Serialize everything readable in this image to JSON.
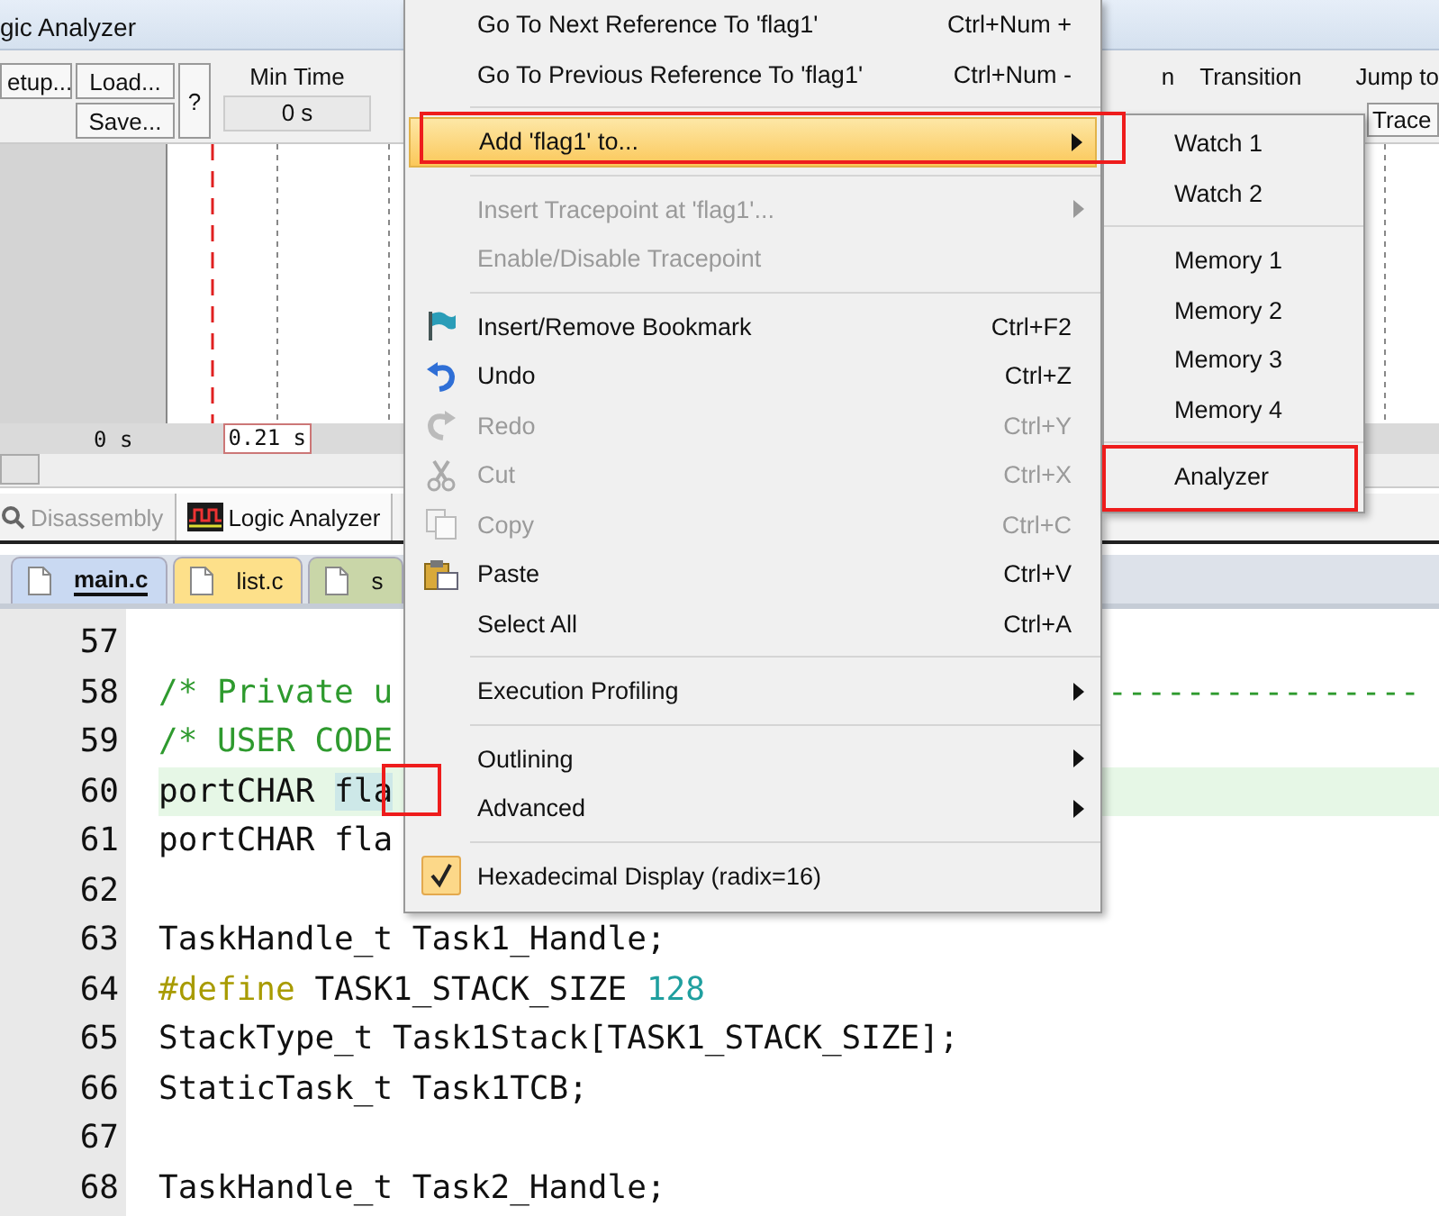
{
  "window": {
    "title": "gic Analyzer"
  },
  "toolbar": {
    "setup": "etup...",
    "load": "Load...",
    "save": "Save...",
    "help": "?",
    "min_time_label": "Min Time",
    "min_time_value": "0 s",
    "cut_label": "n",
    "transition_label": "Transition",
    "jump_label": "Jump to",
    "trace_button": "Trace"
  },
  "plot": {
    "left_time": "0 s",
    "cursor_time": "0.21 s"
  },
  "view_tabs": [
    {
      "label": "Disassembly",
      "selected": false
    },
    {
      "label": "Logic Analyzer",
      "selected": true
    }
  ],
  "file_tabs": [
    {
      "label": "main.c",
      "selected": true,
      "color": "#c9d9f2"
    },
    {
      "label": "list.c",
      "selected": false,
      "color": "#fde08a"
    },
    {
      "label": "s",
      "selected": false,
      "color": "#c9d6a8"
    }
  ],
  "code_lines": [
    {
      "number": "57",
      "highlighted": false
    },
    {
      "number": "58",
      "highlighted": false,
      "parts": [
        {
          "text": "/* Private u",
          "kind": "comment"
        }
      ],
      "tail": "----------------"
    },
    {
      "number": "59",
      "highlighted": false,
      "parts": [
        {
          "text": "/* USER CODE",
          "kind": "comment"
        }
      ]
    },
    {
      "number": "60",
      "highlighted": true,
      "parts": [
        {
          "text": "portCHAR ",
          "kind": "plain"
        },
        {
          "text": "fla",
          "kind": "selected"
        }
      ]
    },
    {
      "number": "61",
      "highlighted": false,
      "parts": [
        {
          "text": "portCHAR fla",
          "kind": "plain"
        }
      ]
    },
    {
      "number": "62",
      "highlighted": false
    },
    {
      "number": "63",
      "highlighted": false,
      "parts": [
        {
          "text": "TaskHandle_t Task1_Handle;",
          "kind": "plain"
        }
      ]
    },
    {
      "number": "64",
      "highlighted": false,
      "parts": [
        {
          "text": "#define",
          "kind": "directive"
        },
        {
          "text": " TASK1_STACK_SIZE ",
          "kind": "plain"
        },
        {
          "text": "128",
          "kind": "number"
        }
      ]
    },
    {
      "number": "65",
      "highlighted": false,
      "parts": [
        {
          "text": "StackType_t Task1Stack[TASK1_STACK_SIZE];",
          "kind": "plain"
        }
      ]
    },
    {
      "number": "66",
      "highlighted": false,
      "parts": [
        {
          "text": "StaticTask_t Task1TCB;",
          "kind": "plain"
        }
      ]
    },
    {
      "number": "67",
      "highlighted": false
    },
    {
      "number": "68",
      "highlighted": false,
      "parts": [
        {
          "text": "TaskHandle_t Task2_Handle;",
          "kind": "plain"
        }
      ]
    }
  ],
  "context_menu": {
    "groups": [
      [
        {
          "label": "Go To Next Reference To 'flag1'",
          "shortcut": "Ctrl+Num +",
          "disabled": false,
          "selected": false,
          "submenu": false,
          "checked": false
        },
        {
          "label": "Go To Previous Reference To 'flag1'",
          "shortcut": "Ctrl+Num -",
          "disabled": false,
          "selected": false,
          "submenu": false,
          "checked": false
        }
      ],
      [
        {
          "label": "Add 'flag1' to...",
          "disabled": false,
          "selected": true,
          "submenu": true,
          "checked": false
        }
      ],
      [
        {
          "label": "Insert Tracepoint at 'flag1'...",
          "disabled": true,
          "selected": false,
          "submenu": true,
          "checked": false
        },
        {
          "label": "Enable/Disable Tracepoint",
          "disabled": true,
          "selected": false,
          "submenu": false,
          "checked": false
        }
      ],
      [
        {
          "label": "Insert/Remove Bookmark",
          "shortcut": "Ctrl+F2",
          "disabled": false,
          "selected": false,
          "submenu": false,
          "checked": false
        },
        {
          "label": "Undo",
          "shortcut": "Ctrl+Z",
          "disabled": false,
          "selected": false,
          "submenu": false,
          "checked": false
        },
        {
          "label": "Redo",
          "shortcut": "Ctrl+Y",
          "disabled": true,
          "selected": false,
          "submenu": false,
          "checked": false
        },
        {
          "label": "Cut",
          "shortcut": "Ctrl+X",
          "disabled": true,
          "selected": false,
          "submenu": false,
          "checked": false
        },
        {
          "label": "Copy",
          "shortcut": "Ctrl+C",
          "disabled": true,
          "selected": false,
          "submenu": false,
          "checked": false
        },
        {
          "label": "Paste",
          "shortcut": "Ctrl+V",
          "disabled": false,
          "selected": false,
          "submenu": false,
          "checked": false
        },
        {
          "label": "Select All",
          "shortcut": "Ctrl+A",
          "disabled": false,
          "selected": false,
          "submenu": false,
          "checked": false
        }
      ],
      [
        {
          "label": "Execution Profiling",
          "disabled": false,
          "selected": false,
          "submenu": true,
          "checked": false
        }
      ],
      [
        {
          "label": "Outlining",
          "disabled": false,
          "selected": false,
          "submenu": true,
          "checked": false
        },
        {
          "label": "Advanced",
          "disabled": false,
          "selected": false,
          "submenu": true,
          "checked": false
        }
      ],
      [
        {
          "label": "Hexadecimal Display (radix=16)",
          "disabled": false,
          "selected": false,
          "submenu": false,
          "checked": true
        }
      ]
    ]
  },
  "submenu": {
    "groups": [
      [
        {
          "label": "Watch 1"
        },
        {
          "label": "Watch 2"
        }
      ],
      [
        {
          "label": "Memory 1"
        },
        {
          "label": "Memory 2"
        },
        {
          "label": "Memory 3"
        },
        {
          "label": "Memory 4"
        }
      ],
      [
        {
          "label": "Analyzer"
        }
      ]
    ]
  }
}
